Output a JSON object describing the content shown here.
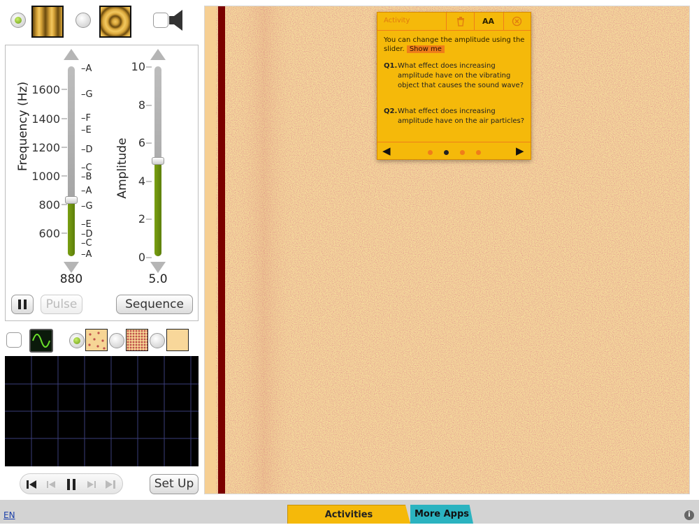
{
  "top": {
    "source_options": [
      "plane-wave-source-icon",
      "point-source-icon"
    ],
    "sound_icon": "speaker-icon"
  },
  "frequency": {
    "label": "Frequency (Hz)",
    "ticks": [
      "1600",
      "1400",
      "1200",
      "1000",
      "800",
      "600"
    ],
    "notes": [
      "A",
      "G",
      "F",
      "E",
      "D",
      "C",
      "B",
      "A",
      "G",
      "E",
      "D",
      "C",
      "A"
    ],
    "readout": "880",
    "value_hz": 880,
    "range_hz": [
      500,
      1800
    ]
  },
  "amplitude": {
    "label": "Amplitude",
    "ticks": [
      "10",
      "8",
      "6",
      "4",
      "2",
      "0"
    ],
    "readout": "5.0",
    "value": 5.0,
    "range": [
      0,
      10
    ]
  },
  "controls": {
    "pause_icon": "pause-icon",
    "pulse_label": "Pulse",
    "sequence_label": "Sequence"
  },
  "view_options": [
    "waveform-icon",
    "sparse-particles-icon",
    "dense-particles-icon",
    "plain-background-icon"
  ],
  "playback": {
    "icons": [
      "rewind-icon",
      "step-back-icon",
      "pause-icon",
      "step-forward-icon",
      "fast-forward-icon"
    ],
    "setup_label": "Set Up"
  },
  "activity": {
    "title": "Activity",
    "text_size_label": "AA",
    "intro": "You can change the amplitude using the slider.",
    "show_me": "Show me",
    "q1_label": "Q1.",
    "q1_text": "What effect does increasing amplitude have on the vibrating object that causes the sound wave?",
    "q2_label": "Q2.",
    "q2_text": "What effect does increasing amplitude have on the air particles?",
    "prev_icon": "◀",
    "next_icon": "▶",
    "page_index": 2,
    "page_count": 4
  },
  "footer": {
    "language": "EN",
    "activities_label": "Activities",
    "more_apps_label": "More Apps",
    "info_icon": "i"
  },
  "colors": {
    "accent_green": "#7aa012",
    "popup_yellow": "#f5b90a",
    "popup_orange": "#ef7d1a",
    "source_bar": "#7a0000",
    "medium_bg": "#f4d89b",
    "particle": "#c0504a"
  }
}
